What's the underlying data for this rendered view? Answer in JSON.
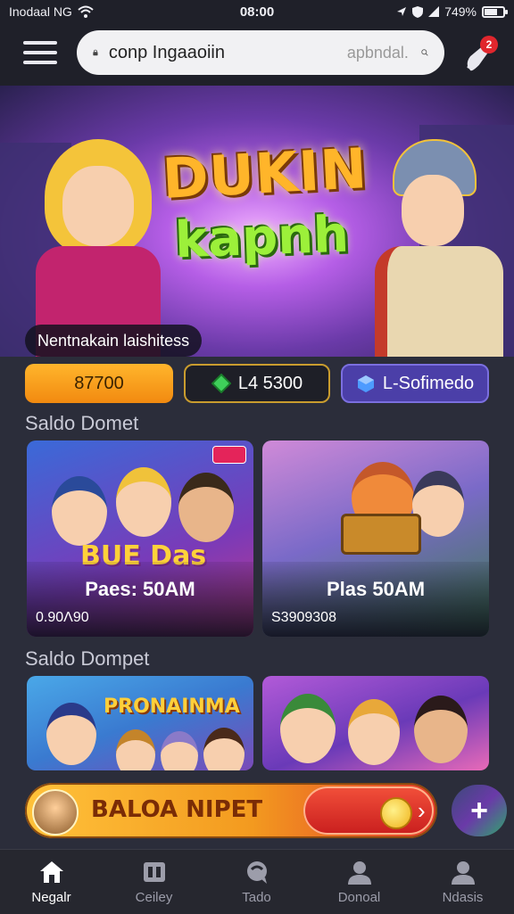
{
  "status_bar": {
    "carrier": "Inodaal NG",
    "time": "08:00",
    "battery": "749%",
    "battery_level": 0.7
  },
  "header": {
    "search_value": "conp Ingaaoiin",
    "search_placeholder": "apbndal.",
    "notification_count": "2"
  },
  "hero": {
    "title_line1": "DUKIN",
    "title_line2": "kapnh",
    "caption": "Nentnakain laishitess"
  },
  "chips": [
    {
      "label": "87700"
    },
    {
      "label": "L4 5300"
    },
    {
      "label": "L-Sofimedo"
    }
  ],
  "sections": [
    {
      "title": "Saldo Domet",
      "cards": [
        {
          "label": "Paes: 50AM",
          "count": "0.90Λ90",
          "art": "BUE Das"
        },
        {
          "label": "Plas 50AM",
          "count": "S3909308"
        }
      ]
    },
    {
      "title": "Saldo Dompet",
      "cards": [
        {
          "art": "PRONAINMA"
        },
        {}
      ]
    }
  ],
  "promo": {
    "label": "BALOA NIPET",
    "add_symbol": "+"
  },
  "nav": [
    {
      "label": "Negalr",
      "icon": "home-icon",
      "active": true
    },
    {
      "label": "Ceiley",
      "icon": "gallery-icon",
      "active": false
    },
    {
      "label": "Tado",
      "icon": "chat-icon",
      "active": false
    },
    {
      "label": "Donoal",
      "icon": "user-icon",
      "active": false
    },
    {
      "label": "Ndasis",
      "icon": "profile-icon",
      "active": false
    }
  ],
  "colors": {
    "background": "#2b2d3a",
    "accent_orange": "#f5a21f",
    "accent_purple": "#4b3fa8",
    "badge_red": "#e0262d"
  }
}
